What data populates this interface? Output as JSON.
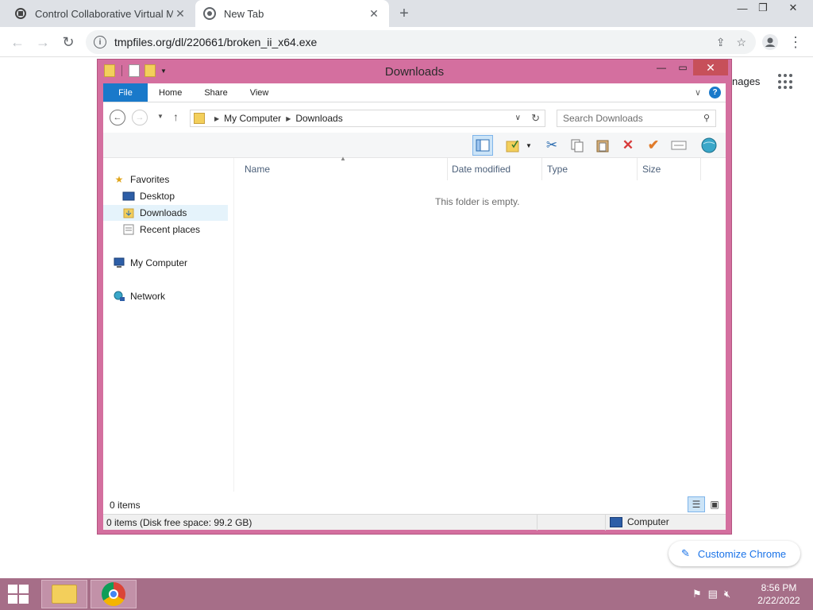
{
  "browser": {
    "tabs": [
      {
        "title": "Control Collaborative Virtual Ma",
        "icon": "vm-icon"
      },
      {
        "title": "New Tab",
        "icon": "chrome-icon"
      }
    ],
    "url": "tmpfiles.org/dl/220661/broken_ii_x64.exe"
  },
  "newtab": {
    "images_link": "nages",
    "customize_label": "Customize Chrome"
  },
  "explorer": {
    "title": "Downloads",
    "ribbon_tabs": [
      "File",
      "Home",
      "Share",
      "View"
    ],
    "breadcrumb": [
      "My Computer",
      "Downloads"
    ],
    "search_placeholder": "Search Downloads",
    "nav": {
      "favorites": "Favorites",
      "desktop": "Desktop",
      "downloads": "Downloads",
      "recent": "Recent places",
      "computer": "My Computer",
      "network": "Network"
    },
    "columns": [
      "Name",
      "Date modified",
      "Type",
      "Size"
    ],
    "empty_message": "This folder is empty.",
    "item_count": "0 items",
    "status_left": "0 items (Disk free space: 99.2 GB)",
    "status_right": "Computer"
  },
  "taskbar": {
    "time": "8:56 PM",
    "date": "2/22/2022"
  }
}
